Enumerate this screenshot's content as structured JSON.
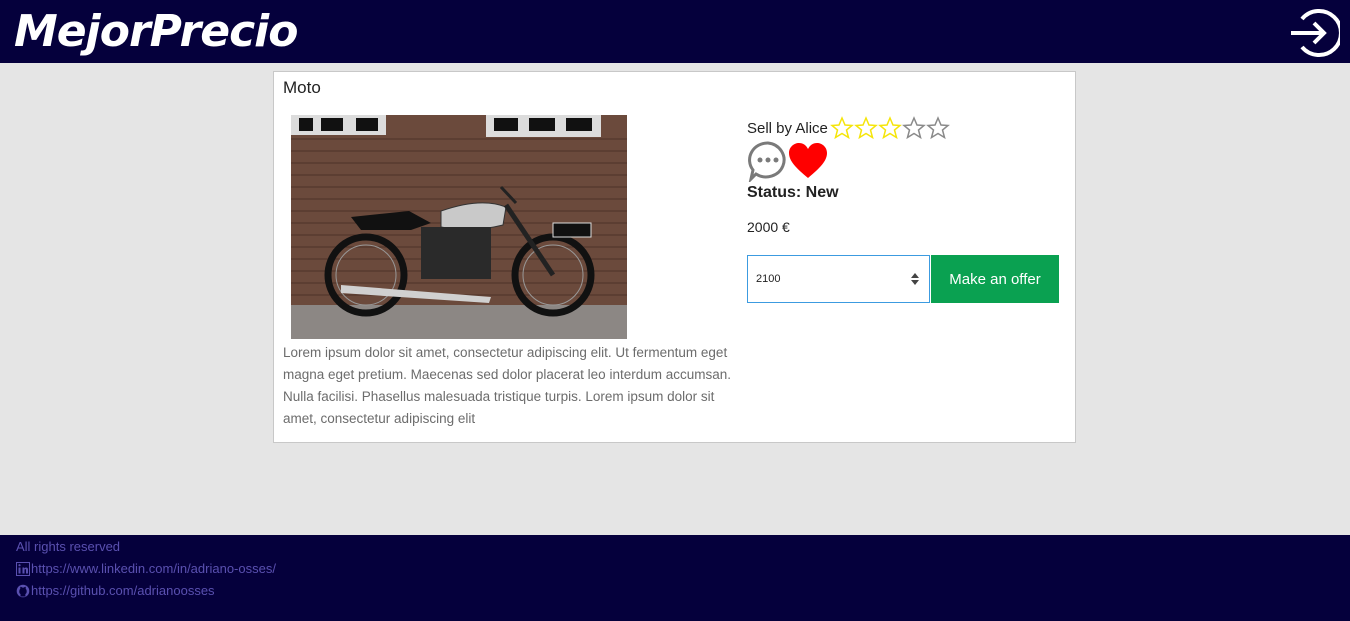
{
  "header": {
    "logo_text": "MejorPrecio",
    "login_icon": "sign-in-icon"
  },
  "product": {
    "title": "Moto",
    "photo_icon": "motorcycle-photo",
    "description": "Lorem ipsum dolor sit amet, consectetur adipiscing elit. Ut fermentum eget magna eget pretium. Maecenas sed dolor placerat leo interdum accumsan. Nulla facilisi. Phasellus malesuada tristique turpis. Lorem ipsum dolor sit amet, consectetur adipiscing elit",
    "seller_label": "Sell by Alice",
    "rating": {
      "value": 3,
      "max": 5,
      "filled_color": "#f5e50a",
      "empty_color": "#8a8a8a"
    },
    "chat_icon": "chat-bubble-icon",
    "favorite_icon": "heart-icon",
    "favorite_color": "#ff0000",
    "status_label": "Status: New",
    "price": "2000 €"
  },
  "offer": {
    "input_value": "2100",
    "button_label": "Make an offer",
    "button_color": "#0aa151"
  },
  "footer": {
    "rights": "All rights reserved",
    "linkedin_url": "https://www.linkedin.com/in/adriano-osses/",
    "github_url": "https://github.com/adrianoosses",
    "linkedin_icon": "linkedin-icon",
    "github_icon": "github-icon"
  }
}
